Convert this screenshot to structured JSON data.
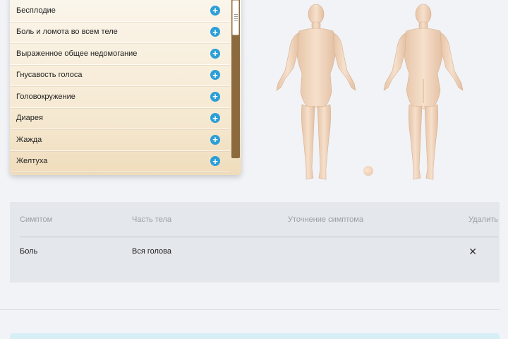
{
  "symptoms": [
    {
      "label": "Бесплодие"
    },
    {
      "label": "Боль и ломота во всем теле"
    },
    {
      "label": "Выраженное общее недомогание"
    },
    {
      "label": "Гнусавость голоса"
    },
    {
      "label": "Головокружение"
    },
    {
      "label": "Диарея"
    },
    {
      "label": "Жажда"
    },
    {
      "label": "Желтуха"
    }
  ],
  "add_glyph": "+",
  "table": {
    "headers": {
      "symptom": "Симптом",
      "body_part": "Часть тела",
      "detail": "Уточнение симптома",
      "delete": "Удалить"
    },
    "rows": [
      {
        "symptom": "Боль",
        "body_part": "Вся голова",
        "detail": "",
        "delete_glyph": "✕"
      }
    ]
  },
  "colors": {
    "add_button": "#2d9fd8",
    "scrollbar": "#8c6a3e",
    "skin": "#f2d9c3"
  }
}
